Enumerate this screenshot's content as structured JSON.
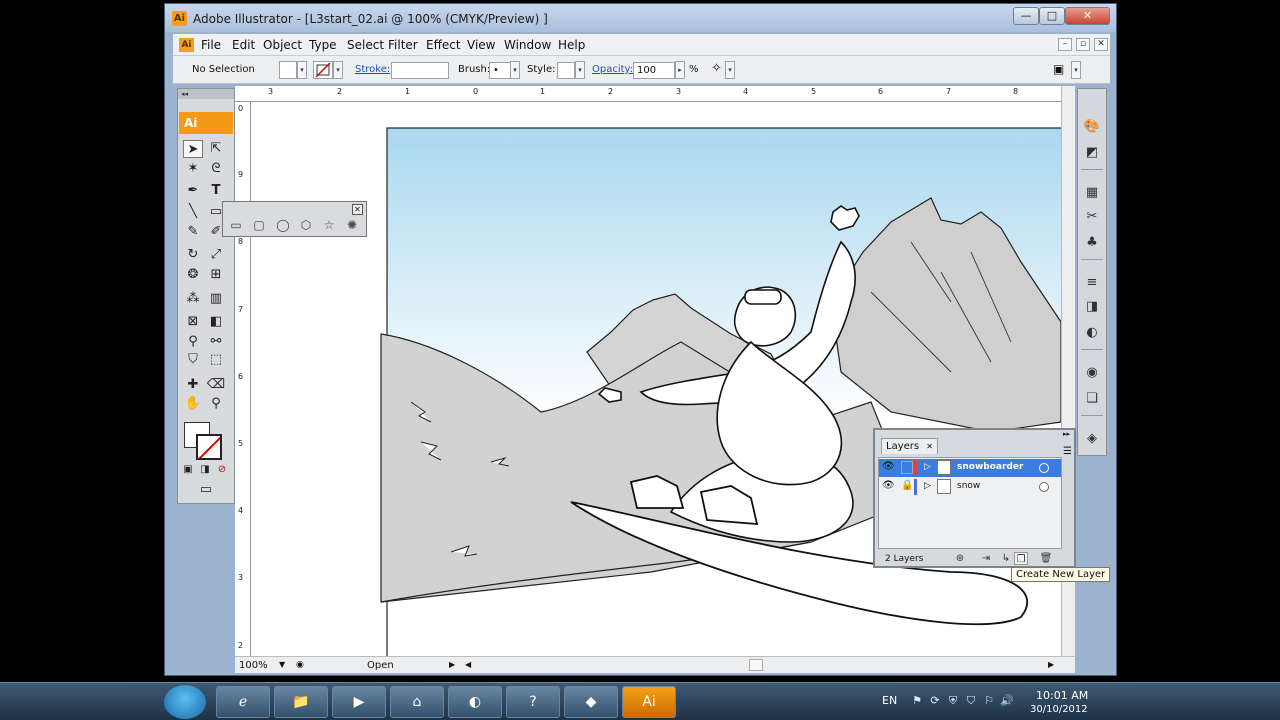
{
  "window": {
    "app_icon": "Ai",
    "title": "Adobe Illustrator - [L3start_02.ai @ 100% (CMYK/Preview) ]",
    "minimize": "—",
    "maximize": "□",
    "close": "✕"
  },
  "menu": {
    "items": [
      "File",
      "Edit",
      "Object",
      "Type",
      "Select",
      "Filter",
      "Effect",
      "View",
      "Window",
      "Help"
    ],
    "doc_controls": [
      "–",
      "▫",
      "✕"
    ]
  },
  "control_bar": {
    "selection_label": "No Selection",
    "stroke_label": "Stroke:",
    "brush_label": "Brush:",
    "brush_value": "•",
    "style_label": "Style:",
    "opacity_label": "Opacity:",
    "opacity_value": "100",
    "opacity_unit": "%"
  },
  "tools": {
    "logo": "Ai",
    "collapse": "◂◂"
  },
  "rulers": {
    "top_labels": [
      "3",
      "2",
      "1",
      "0",
      "1",
      "2",
      "3",
      "4",
      "5",
      "6",
      "7",
      "8"
    ],
    "left_labels": [
      "0",
      "9",
      "8",
      "7",
      "6",
      "5",
      "4",
      "3",
      "2"
    ]
  },
  "status": {
    "zoom": "100%",
    "state": "Open"
  },
  "layers_panel": {
    "tab_label": "Layers",
    "tab_close": "✕",
    "layers": [
      {
        "name": "snowboarder",
        "selected": true,
        "locked": false
      },
      {
        "name": "snow",
        "selected": false,
        "locked": true
      }
    ],
    "count": "2 Layers",
    "tooltip": "Create New Layer"
  },
  "taskbar": {
    "language": "EN",
    "time": "10:01 AM",
    "date": "30/10/2012",
    "active_app": "Ai"
  },
  "colors": {
    "accent": "#f59a17",
    "selection_blue": "#3a7dde",
    "sky_top": "#a9d8ef"
  }
}
